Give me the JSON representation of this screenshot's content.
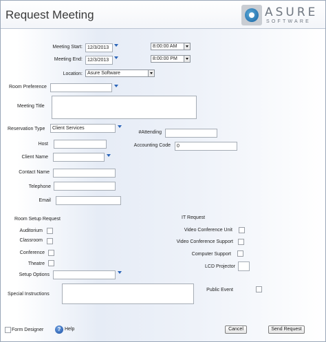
{
  "header": {
    "title": "Request Meeting",
    "logo": {
      "line1": "ASURE",
      "line2": "SOFTWARE",
      "icon": "asure-logo-icon"
    }
  },
  "meeting": {
    "start_label": "Meeting Start:",
    "start_date": "12/3/2013",
    "start_time": "8:00:00 AM",
    "end_label": "Meeting End:",
    "end_date": "12/3/2013",
    "end_time": "8:00:00 PM",
    "location_label": "Location:",
    "location_value": "Asure Software"
  },
  "form": {
    "room_preference_label": "Room Preference",
    "room_preference_value": "",
    "meeting_title_label": "Meeting Title",
    "reservation_type_label": "Reservation Type",
    "reservation_type_value": "Client Services",
    "attending_label": "#Attending",
    "attending_value": "",
    "host_label": "Host",
    "accounting_code_label": "Accounting Code",
    "accounting_code_value": "0",
    "client_name_label": "Client Name",
    "contact_name_label": "Contact Name",
    "telephone_label": "Telephone",
    "email_label": "Email"
  },
  "room_setup": {
    "heading": "Room Setup Request",
    "items": [
      "Auditorium",
      "Classroom",
      "Conference",
      "Theatre"
    ],
    "setup_options_label": "Setup Options"
  },
  "it_request": {
    "heading": "IT Request",
    "items": [
      "Video Conference Unit",
      "Video Conference Support",
      "Computer Support"
    ],
    "lcd_projector_label": "LCD Projector",
    "public_event_label": "Public Event"
  },
  "special_instructions_label": "Special Instructions",
  "footer": {
    "form_designer_label": "Form Designer",
    "help_label": "Help",
    "cancel_label": "Cancel",
    "send_label": "Send Request"
  }
}
